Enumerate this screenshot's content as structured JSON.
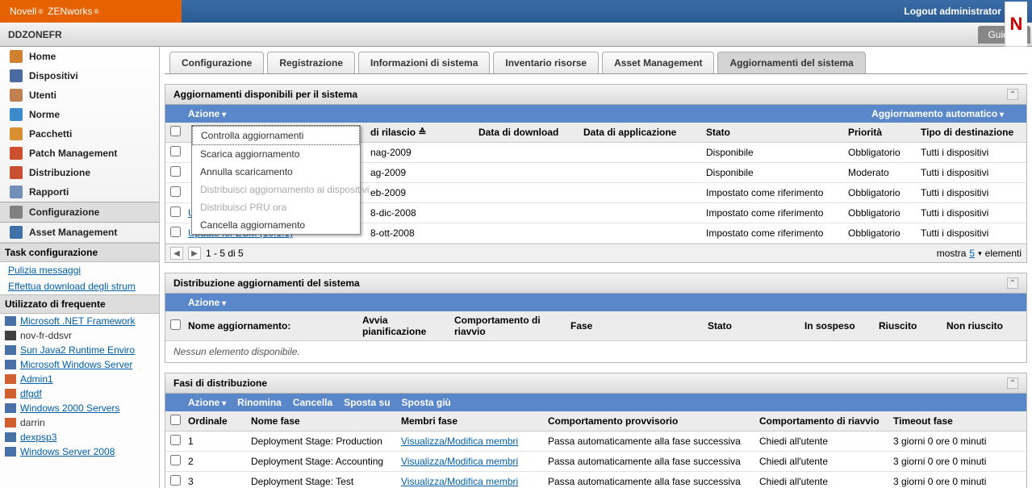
{
  "header": {
    "brand1": "Novell",
    "brand2": "ZENworks",
    "logout": "Logout administrator",
    "zone": "DDZONEFR",
    "guida": "Guida",
    "n": "N"
  },
  "nav": [
    {
      "label": "Home",
      "icon": "#d08030"
    },
    {
      "label": "Dispositivi",
      "icon": "#4a6aa0"
    },
    {
      "label": "Utenti",
      "icon": "#c08050"
    },
    {
      "label": "Norme",
      "icon": "#3c8ccc"
    },
    {
      "label": "Pacchetti",
      "icon": "#d89030"
    },
    {
      "label": "Patch Management",
      "icon": "#cc5030"
    },
    {
      "label": "Distribuzione",
      "icon": "#c85030"
    },
    {
      "label": "Rapporti",
      "icon": "#7090b8"
    },
    {
      "label": "Configurazione",
      "icon": "#808080",
      "selected": true
    },
    {
      "label": "Asset Management",
      "icon": "#4070a8"
    }
  ],
  "task_section": "Task configurazione",
  "task_links": [
    "Pulizia messaggi",
    "Effettua download degli strum"
  ],
  "freq_section": "Utilizzato di frequente",
  "freq_items": [
    {
      "label": "Microsoft .NET Framework",
      "color": "#4a70a8"
    },
    {
      "label": "nov-fr-ddsvr",
      "color": "#404040",
      "nolink": true
    },
    {
      "label": "Sun Java2 Runtime Enviro",
      "color": "#4a70a8"
    },
    {
      "label": "Microsoft Windows Server",
      "color": "#4a70a8"
    },
    {
      "label": "Admin1",
      "color": "#d06030"
    },
    {
      "label": "dfgdf",
      "color": "#d06030"
    },
    {
      "label": "Windows 2000 Servers",
      "color": "#4a70a8"
    },
    {
      "label": "darrin",
      "color": "#d06030",
      "nolink": true
    },
    {
      "label": "dexpsp3",
      "color": "#4a70a8"
    },
    {
      "label": "Windows Server 2008",
      "color": "#4a70a8"
    }
  ],
  "tabs": [
    "Configurazione",
    "Registrazione",
    "Informazioni di sistema",
    "Inventario risorse",
    "Asset Management",
    "Aggiornamenti del sistema"
  ],
  "active_tab": 5,
  "panel1": {
    "title": "Aggiornamenti disponibili per il sistema",
    "action": "Azione",
    "auto": "Aggiornamento automatico",
    "menu": [
      {
        "label": "Controlla aggiornamenti",
        "sel": true
      },
      {
        "label": "Scarica aggiornamento"
      },
      {
        "label": "Annulla scaricamento"
      },
      {
        "label": "Distribuisci aggiornamento ai dispositivi",
        "disabled": true
      },
      {
        "label": "Distribuisci PRU ora",
        "disabled": true
      },
      {
        "label": "Cancella aggiornamento"
      }
    ],
    "cols": {
      "name": "",
      "rel": "di rilascio ≙",
      "dl": "Data di download",
      "app": "Data di applicazione",
      "stato": "Stato",
      "prio": "Priorità",
      "tipo": "Tipo di destinazione"
    },
    "rows": [
      {
        "rel": "nag-2009",
        "stato": "Disponibile",
        "prio": "Obbligatorio",
        "tipo": "Tutti i dispositivi"
      },
      {
        "rel": "ag-2009",
        "stato": "Disponibile",
        "prio": "Moderato",
        "tipo": "Tutti i dispositivi"
      },
      {
        "rel": "eb-2009",
        "stato": "Impostato come riferimento",
        "prio": "Obbligatorio",
        "tipo": "Tutti i dispositivi"
      },
      {
        "name": "Update for ZCM (10.1.2a)",
        "rel": "8-dic-2008",
        "stato": "Impostato come riferimento",
        "prio": "Obbligatorio",
        "tipo": "Tutti i dispositivi"
      },
      {
        "name": "Update for ZCM (10.1.1)",
        "rel": "8-ott-2008",
        "stato": "Impostato come riferimento",
        "prio": "Obbligatorio",
        "tipo": "Tutti i dispositivi"
      }
    ],
    "pager": {
      "range": "1 - 5 di 5",
      "mostra": "mostra",
      "num": "5",
      "elementi": "elementi"
    }
  },
  "panel2": {
    "title": "Distribuzione aggiornamenti del sistema",
    "action": "Azione",
    "cols": {
      "name": "Nome aggiornamento:",
      "avvia": "Avvia pianificazione",
      "comp": "Comportamento di riavvio",
      "fase": "Fase",
      "stato": "Stato",
      "sosp": "In sospeso",
      "riusc": "Riuscito",
      "nonr": "Non riuscito"
    },
    "empty": "Nessun elemento disponibile."
  },
  "panel3": {
    "title": "Fasi di distribuzione",
    "actions": {
      "azione": "Azione",
      "rinomina": "Rinomina",
      "cancella": "Cancella",
      "sposta_su": "Sposta su",
      "sposta_giu": "Sposta giù"
    },
    "cols": {
      "ord": "Ordinale",
      "name": "Nome fase",
      "mem": "Membri fase",
      "comp": "Comportamento provvisorio",
      "riav": "Comportamento di riavvio",
      "time": "Timeout fase"
    },
    "rows": [
      {
        "ord": "1",
        "name": "Deployment Stage: Production",
        "mem": "Visualizza/Modifica membri",
        "comp": "Passa automaticamente alla fase successiva",
        "riav": "Chiedi all'utente",
        "time": "3 giorni 0 ore 0 minuti"
      },
      {
        "ord": "2",
        "name": "Deployment Stage: Accounting",
        "mem": "Visualizza/Modifica membri",
        "comp": "Passa automaticamente alla fase successiva",
        "riav": "Chiedi all'utente",
        "time": "3 giorni 0 ore 0 minuti"
      },
      {
        "ord": "3",
        "name": "Deployment Stage: Test",
        "mem": "Visualizza/Modifica membri",
        "comp": "Passa automaticamente alla fase successiva",
        "riav": "Chiedi all'utente",
        "time": "3 giorni 0 ore 0 minuti"
      }
    ]
  }
}
